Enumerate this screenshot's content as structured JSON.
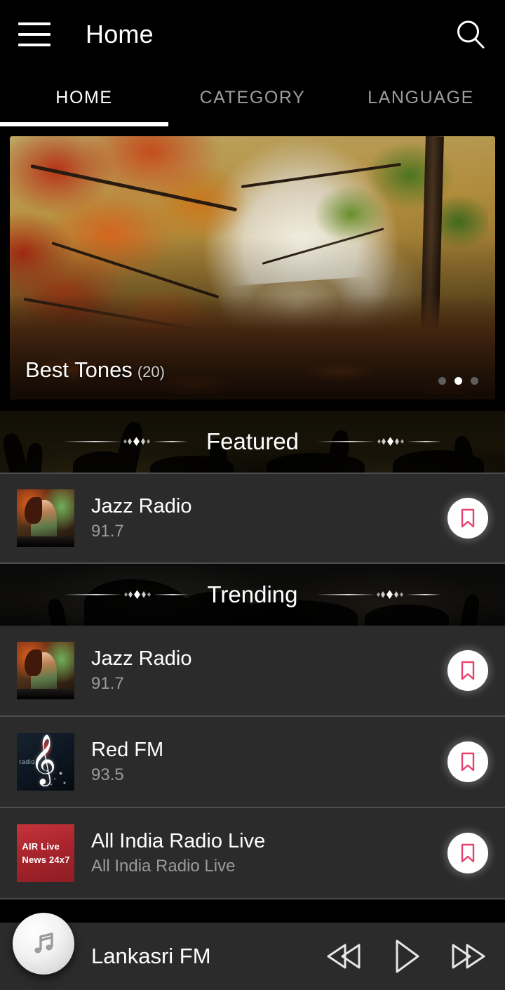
{
  "header": {
    "menu_icon": "hamburger-menu-icon",
    "title": "Home",
    "search_icon": "search-icon"
  },
  "tabs": [
    {
      "label": "HOME",
      "active": true
    },
    {
      "label": "CATEGORY",
      "active": false
    },
    {
      "label": "LANGUAGE",
      "active": false
    }
  ],
  "hero": {
    "caption_title": "Best Tones",
    "caption_count": "(20)",
    "dots": [
      {
        "active": false
      },
      {
        "active": true
      },
      {
        "active": false
      }
    ]
  },
  "sections": [
    {
      "title": "Featured",
      "items": [
        {
          "name": "Jazz Radio",
          "frequency": "91.7",
          "thumb": "jazz-dj-thumbnail",
          "bookmark_icon": "bookmark-icon"
        }
      ]
    },
    {
      "title": "Trending",
      "items": [
        {
          "name": "Jazz Radio",
          "frequency": "91.7",
          "thumb": "jazz-dj-thumbnail",
          "bookmark_icon": "bookmark-icon"
        },
        {
          "name": "Red FM",
          "frequency": "93.5",
          "thumb": "red-fm-thumbnail",
          "thumb_text": "radio",
          "bookmark_icon": "bookmark-icon"
        },
        {
          "name": "All India Radio Live",
          "frequency": "All India Radio Live",
          "thumb": "air-live-thumbnail",
          "thumb_line1": "AIR Live",
          "thumb_line2": "News 24x7",
          "bookmark_icon": "bookmark-icon"
        }
      ]
    }
  ],
  "player": {
    "artwork_icon": "music-note-icon",
    "now_playing": "Lankasri FM",
    "prev_icon": "rewind-icon",
    "play_icon": "play-icon",
    "next_icon": "fast-forward-icon"
  },
  "colors": {
    "accent_bookmark": "#e8416d",
    "row_background": "#2b2b2b",
    "app_background": "#000000",
    "separator": "#4d4d4d",
    "active_tab": "#ffffff",
    "inactive_tab": "#9d9d9d"
  }
}
